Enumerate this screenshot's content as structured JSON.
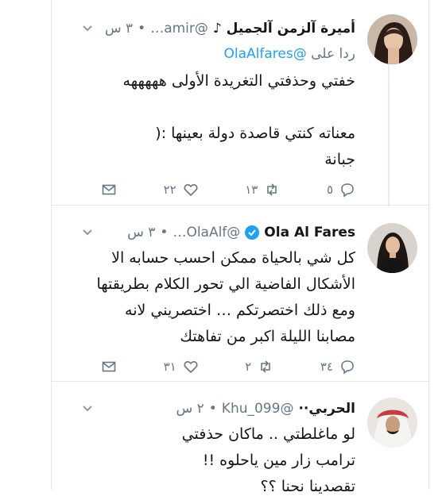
{
  "tweets": [
    {
      "name": "أميرة آلزمن آلجميل ♪",
      "handle": "@amir…",
      "dot": "•",
      "time": "٣ س",
      "reply_prefix": "ردا على",
      "reply_handle": "@OlaAlfares",
      "lines": [
        "خفتي وحذفتي التغريدة الأولى هههههه",
        "",
        "معناته كنتي قاصدة دولة بعينها :(",
        "جبانة"
      ],
      "replies": "٥",
      "retweets": "١٣",
      "likes": "٢٢"
    },
    {
      "name": "Ola Al Fares",
      "handle": "@OlaAlf…",
      "dot": "•",
      "time": "٣ س",
      "lines": [
        "كل شي بالحياة ممكن احسب حسابه الا",
        "الأشكال الفاضية الي تحور الكلام بطريقتها",
        "ومع ذلك اختصرتكم … اختصريني لانه",
        "مصابنا الليلة اكبر من تفاهتك"
      ],
      "replies": "٣٤",
      "retweets": "٢",
      "likes": "٣١"
    },
    {
      "name": "الحربي··",
      "handle": "@Khu_099",
      "dot": "•",
      "time": "٢ س",
      "lines": [
        "لو ماغلطتي .. ماكان حذفتي",
        "ترامب زار مين ياحلوه !!",
        "تقصدينا نحنا ؟؟"
      ]
    }
  ],
  "colors": {
    "accent": "#1da1f2",
    "muted": "#657786",
    "border": "#e1e8ed"
  },
  "icons": [
    "chevron-down-icon",
    "verified-icon",
    "reply-icon",
    "retweet-icon",
    "like-icon",
    "direct-message-icon"
  ]
}
